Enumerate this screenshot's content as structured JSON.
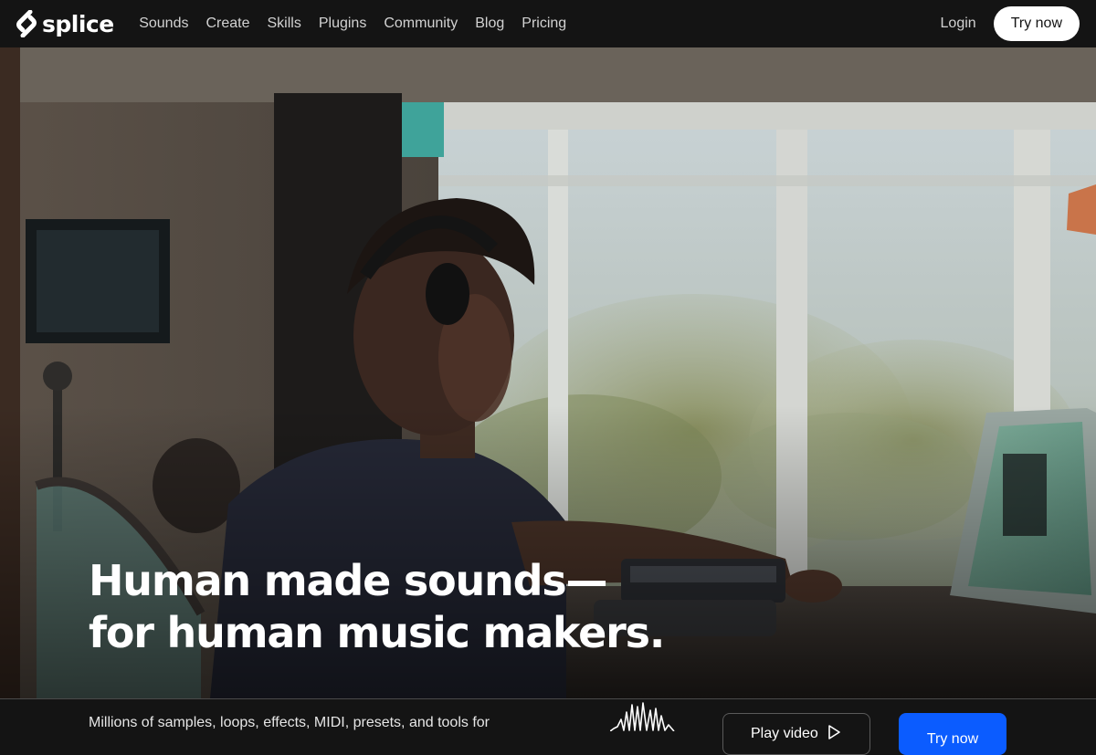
{
  "brand": {
    "name": "splice",
    "icon": "splice-logo-icon"
  },
  "nav": {
    "links": [
      "Sounds",
      "Create",
      "Skills",
      "Plugins",
      "Community",
      "Blog",
      "Pricing"
    ],
    "login_label": "Login",
    "try_label": "Try now"
  },
  "hero": {
    "headline_line1": "Human made sounds—",
    "headline_line2": "for human music makers.",
    "image_subject": "producer-with-headphones-at-keyboard-photo"
  },
  "bottom": {
    "description": "Millions of samples, loops, effects, MIDI, presets, and tools for",
    "play_label": "Play video",
    "play_icon": "play-icon",
    "cta_label": "Try now",
    "cta_color": "#0b5cff"
  },
  "colors": {
    "nav_background": "#141414",
    "primary_cta": "#0b5cff",
    "nav_button_bg": "#ffffff"
  }
}
